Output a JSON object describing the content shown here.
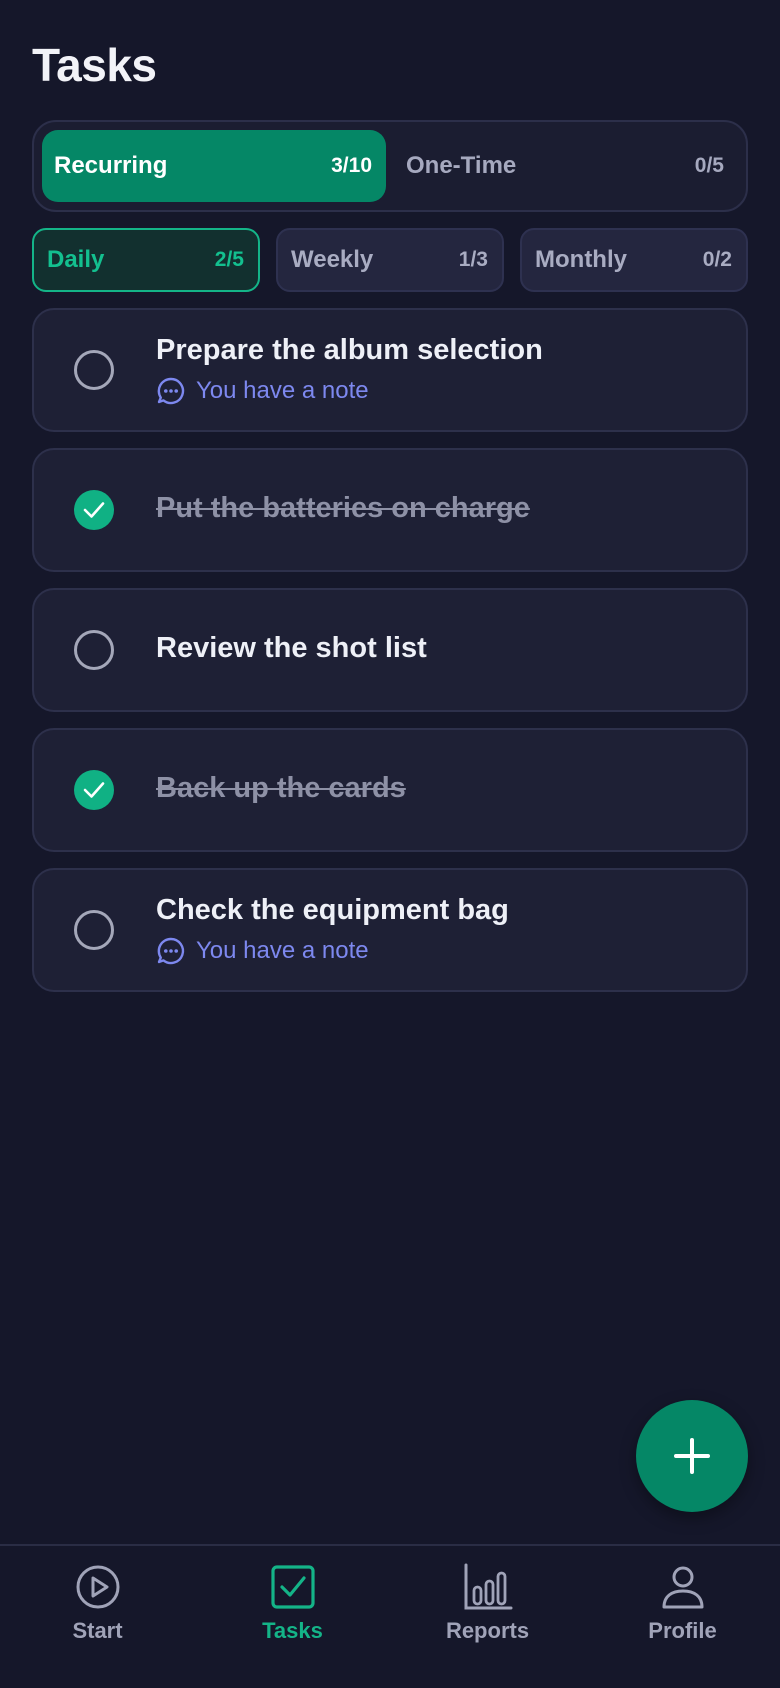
{
  "header": {
    "title": "Tasks"
  },
  "segments": [
    {
      "label": "Recurring",
      "count": "3/10",
      "active": true
    },
    {
      "label": "One-Time",
      "count": "0/5",
      "active": false
    }
  ],
  "filters": [
    {
      "label": "Daily",
      "count": "2/5",
      "active": true
    },
    {
      "label": "Weekly",
      "count": "1/3",
      "active": false
    },
    {
      "label": "Monthly",
      "count": "0/2",
      "active": false
    }
  ],
  "tasks": [
    {
      "title": "Prepare the album selection",
      "done": false,
      "note": "You have a note"
    },
    {
      "title": "Put the batteries on charge",
      "done": true,
      "note": null
    },
    {
      "title": "Review the shot list",
      "done": false,
      "note": null
    },
    {
      "title": "Back up the cards",
      "done": true,
      "note": null
    },
    {
      "title": "Check the equipment bag",
      "done": false,
      "note": "You have a note"
    }
  ],
  "fab": {
    "icon": "plus-icon"
  },
  "nav": [
    {
      "label": "Start",
      "icon": "play-circle-icon",
      "active": false
    },
    {
      "label": "Tasks",
      "icon": "checkbox-icon",
      "active": true
    },
    {
      "label": "Reports",
      "icon": "bar-chart-icon",
      "active": false
    },
    {
      "label": "Profile",
      "icon": "user-icon",
      "active": false
    }
  ],
  "colors": {
    "background": "#15172a",
    "accent": "#058766",
    "accent_text": "#14b488",
    "note": "#7d88ef",
    "card": "#1e2035"
  }
}
